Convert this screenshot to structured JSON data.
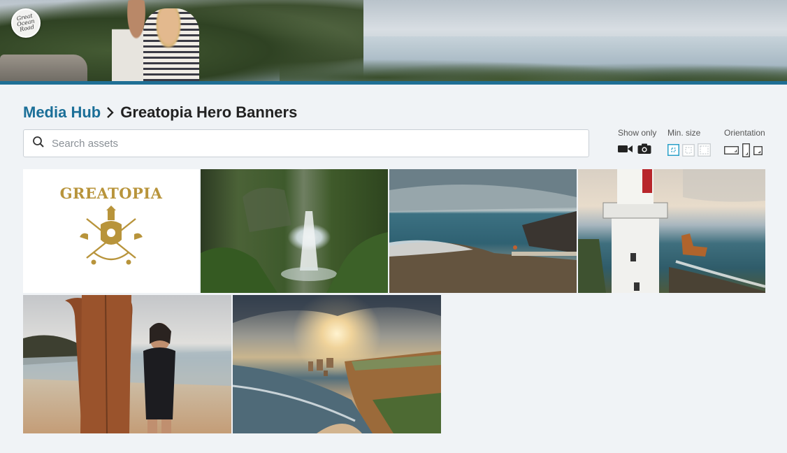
{
  "header": {
    "logo_alt": "Great Ocean Road",
    "logo_text": "Great Ocean Road"
  },
  "breadcrumb": {
    "parent": "Media Hub",
    "current": "Greatopia Hero Banners"
  },
  "search": {
    "placeholder": "Search assets",
    "value": ""
  },
  "filters": {
    "show_only": {
      "label": "Show only",
      "options": [
        "video-icon",
        "camera-icon"
      ]
    },
    "min_size": {
      "label": "Min. size",
      "options": [
        "size-small-icon",
        "size-medium-icon",
        "size-large-icon"
      ],
      "selected": 0
    },
    "orientation": {
      "label": "Orientation",
      "options": [
        "landscape-icon",
        "portrait-icon",
        "square-icon"
      ]
    }
  },
  "assets": [
    {
      "kind": "logo",
      "brand": "GREATOPIA"
    },
    {
      "kind": "photo",
      "subject": "waterfall"
    },
    {
      "kind": "photo",
      "subject": "coastal-lookout"
    },
    {
      "kind": "photo",
      "subject": "lighthouse"
    },
    {
      "kind": "photo",
      "subject": "surfer"
    },
    {
      "kind": "photo",
      "subject": "twelve-apostles"
    }
  ],
  "colors": {
    "accent": "#1b6f98",
    "header_bar": "#1f6f95",
    "page_bg": "#f0f3f6",
    "brand_gold": "#b8943b",
    "selected_filter": "#2aa0c8"
  }
}
